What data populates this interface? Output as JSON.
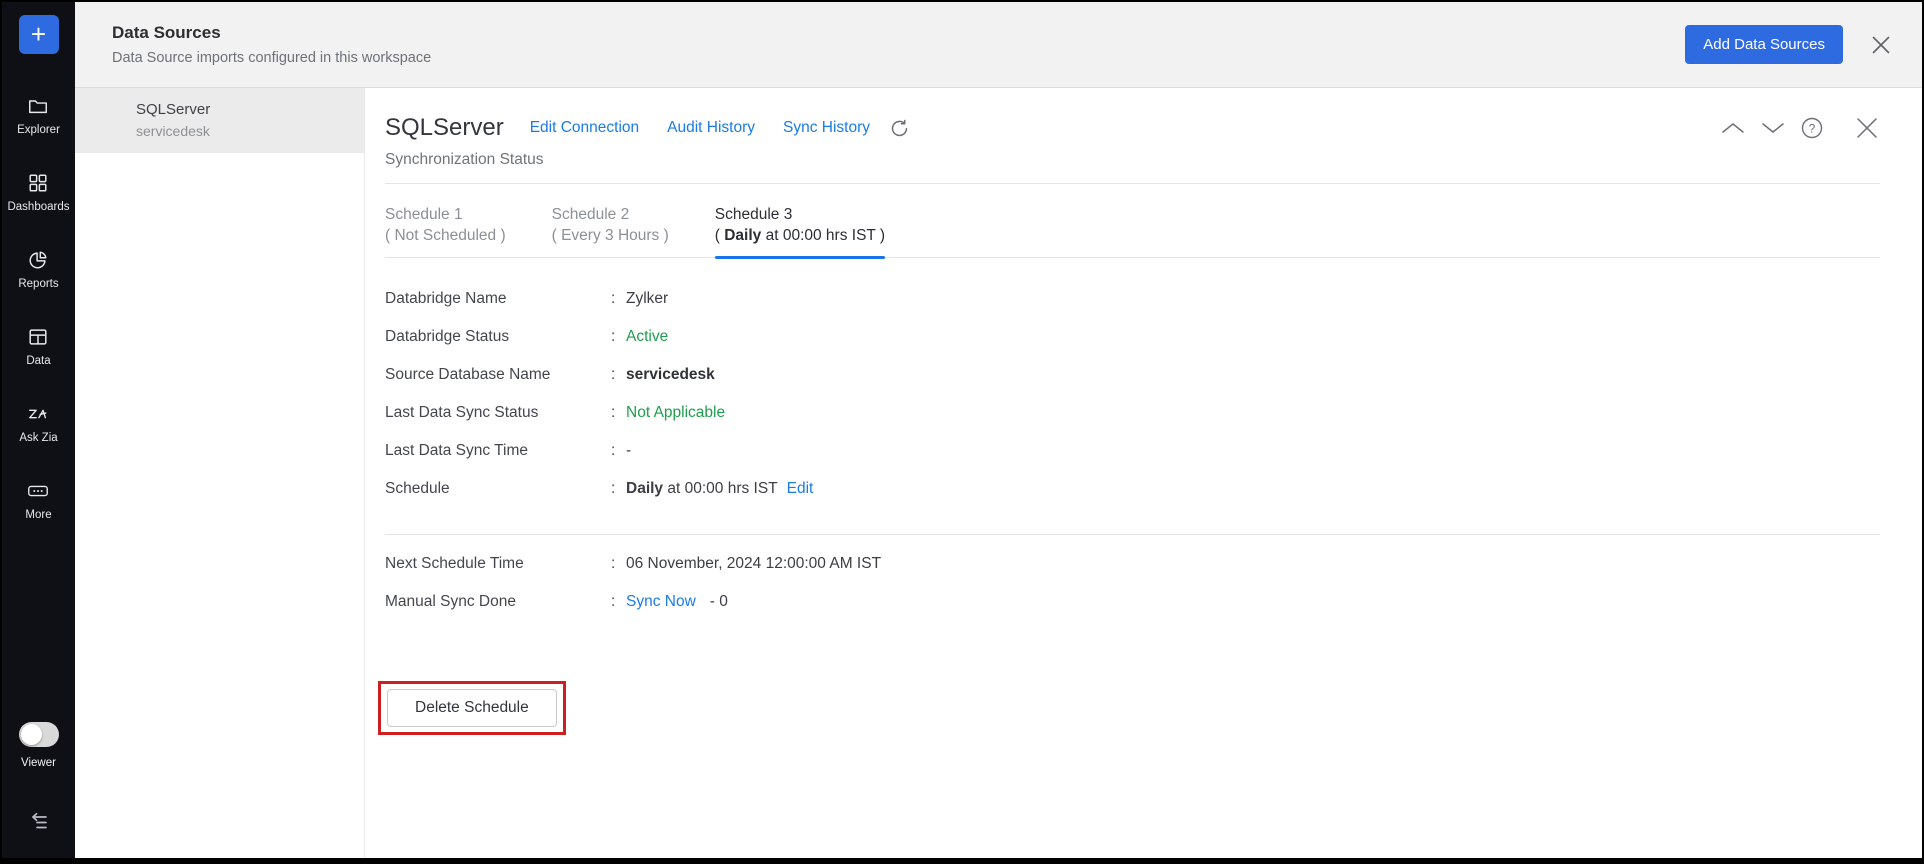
{
  "header": {
    "title": "Data Sources",
    "subtitle": "Data Source imports configured in this workspace",
    "add_button": "Add Data Sources"
  },
  "sidebar": {
    "plus_label": "+",
    "items": [
      {
        "icon": "folder-icon",
        "label": "Explorer"
      },
      {
        "icon": "grid-icon",
        "label": "Dashboards"
      },
      {
        "icon": "pie-chart-icon",
        "label": "Reports"
      },
      {
        "icon": "table-icon",
        "label": "Data"
      },
      {
        "icon": "zia-icon",
        "label": "Ask Zia"
      },
      {
        "icon": "ellipsis-icon",
        "label": "More"
      }
    ],
    "viewer_toggle": {
      "label": "Viewer",
      "state": "off"
    }
  },
  "list_panel": {
    "items": [
      {
        "name": "SQLServer",
        "database": "servicedesk",
        "selected": true
      }
    ]
  },
  "main": {
    "title": "SQLServer",
    "links": [
      "Edit Connection",
      "Audit History",
      "Sync History"
    ],
    "section_title": "Synchronization Status",
    "colon": ":",
    "tabs": [
      {
        "line1": "Schedule 1",
        "line2": "( Not Scheduled )",
        "active": false
      },
      {
        "line1": "Schedule 2",
        "line2": "( Every 3 Hours )",
        "active": false
      },
      {
        "line1": "Schedule 3",
        "line2_prefix": "( ",
        "line2_bold": "Daily",
        "line2_rest": " at 00:00 hrs IST )",
        "active": true
      }
    ],
    "details": {
      "databridge_name": {
        "label": "Databridge Name",
        "value": "Zylker"
      },
      "databridge_status": {
        "label": "Databridge Status",
        "value": "Active"
      },
      "source_database": {
        "label": "Source Database Name",
        "value": "servicedesk"
      },
      "last_sync_status": {
        "label": "Last Data Sync Status",
        "value": "Not Applicable"
      },
      "last_sync_time": {
        "label": "Last Data Sync Time",
        "value": "-"
      },
      "schedule": {
        "label": "Schedule",
        "value_bold": "Daily",
        "value_rest": " at 00:00 hrs IST",
        "edit_link": "Edit"
      }
    },
    "footer_details": {
      "next_schedule": {
        "label": "Next Schedule Time",
        "value": "06 November, 2024 12:00:00 AM IST"
      },
      "manual_sync": {
        "label": "Manual Sync Done",
        "link": "Sync Now",
        "value": "- 0"
      }
    },
    "delete_button": "Delete Schedule",
    "colors": {
      "accent_blue": "#2e6be0",
      "link_blue": "#1b7ce8",
      "tab_underline_blue": "#1a73e8",
      "status_green": "#1f9e4e",
      "annotation_red": "#cd1f1f"
    }
  }
}
